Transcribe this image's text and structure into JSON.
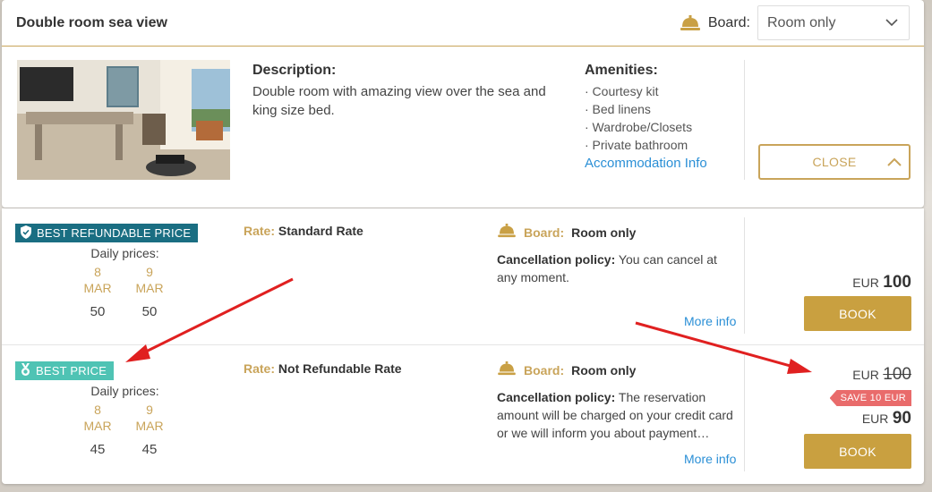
{
  "room": {
    "title": "Double room sea view",
    "board_label": "Board:",
    "board_value": "Room only",
    "description_title": "Description:",
    "description_text": "Double room with amazing view over the sea and king size bed.",
    "amenities_title": "Amenities:",
    "amenities": [
      "· Courtesy kit",
      "· Bed linens",
      "· Wardrobe/Closets",
      "· Private bathroom"
    ],
    "accommodation_link": "Accommodation Info",
    "close_label": "CLOSE"
  },
  "rates": [
    {
      "badge": "BEST REFUNDABLE PRICE",
      "daily_label": "Daily prices:",
      "days": [
        {
          "day": "8",
          "month": "MAR",
          "price": "50"
        },
        {
          "day": "9",
          "month": "MAR",
          "price": "50"
        }
      ],
      "rate_label": "Rate:",
      "rate_name": "Standard Rate",
      "board_label": "Board:",
      "board_value": "Room only",
      "cancel_label": "Cancellation policy:",
      "cancel_text": "You can cancel at any moment.",
      "more_info": "More info",
      "currency": "EUR",
      "price": "100",
      "book_label": "BOOK"
    },
    {
      "badge": "BEST PRICE",
      "daily_label": "Daily prices:",
      "days": [
        {
          "day": "8",
          "month": "MAR",
          "price": "45"
        },
        {
          "day": "9",
          "month": "MAR",
          "price": "45"
        }
      ],
      "rate_label": "Rate:",
      "rate_name": "Not Refundable Rate",
      "board_label": "Board:",
      "board_value": "Room only",
      "cancel_label": "Cancellation policy:",
      "cancel_text": "The reservation amount will be charged on your credit card or we will inform you about payment…",
      "more_info": "More info",
      "currency": "EUR",
      "old_price": "100",
      "save_label": "SAVE 10 EUR",
      "price": "90",
      "book_label": "BOOK"
    }
  ],
  "colors": {
    "gold": "#c9a45a",
    "button_gold": "#c9a040",
    "badge_refundable": "#1a6e82",
    "badge_best": "#4fc3b4",
    "link_blue": "#2a8fd6",
    "save_red": "#e96b6b",
    "arrow_red": "#e02020"
  },
  "icons": [
    "bell-icon",
    "chevron-down-icon",
    "chevron-up-icon",
    "shield-check-icon",
    "medal-icon"
  ]
}
